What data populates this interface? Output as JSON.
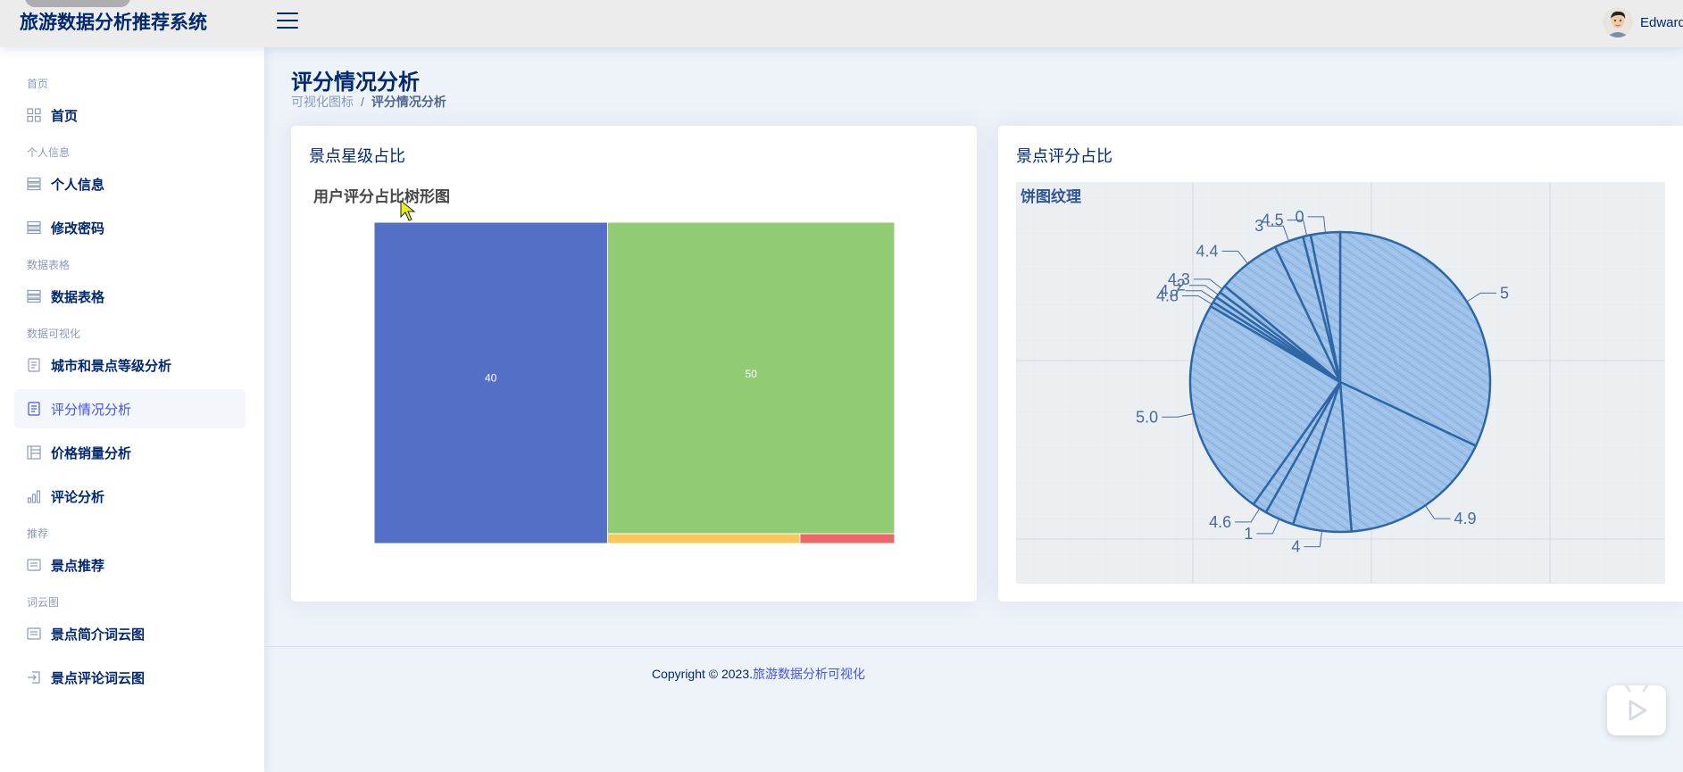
{
  "header": {
    "brand": "旅游数据分析推荐系统",
    "user_name": "Edward"
  },
  "sidebar": {
    "sections": [
      {
        "heading": "首页",
        "items": [
          {
            "label": "首页",
            "icon": "grid-icon"
          }
        ]
      },
      {
        "heading": "个人信息",
        "items": [
          {
            "label": "个人信息",
            "icon": "profile-icon"
          },
          {
            "label": "修改密码",
            "icon": "key-icon"
          }
        ]
      },
      {
        "heading": "数据表格",
        "items": [
          {
            "label": "数据表格",
            "icon": "table-icon"
          }
        ]
      },
      {
        "heading": "数据可视化",
        "items": [
          {
            "label": "城市和景点等级分析",
            "icon": "document-icon"
          },
          {
            "label": "评分情况分析",
            "icon": "document-icon",
            "active": true
          },
          {
            "label": "价格销量分析",
            "icon": "layout-icon"
          },
          {
            "label": "评论分析",
            "icon": "bar-chart-icon"
          }
        ]
      },
      {
        "heading": "推荐",
        "items": [
          {
            "label": "景点推荐",
            "icon": "card-icon"
          }
        ]
      },
      {
        "heading": "词云图",
        "items": [
          {
            "label": "景点简介词云图",
            "icon": "card-list-icon"
          },
          {
            "label": "景点评论词云图",
            "icon": "login-icon"
          }
        ]
      }
    ]
  },
  "page": {
    "title": "评分情况分析",
    "breadcrumb": [
      "可视化图标",
      "评分情况分析"
    ]
  },
  "cards": {
    "left": {
      "title": "景点星级占比",
      "chart_title": "用户评分占比树形图"
    },
    "right": {
      "title": "景点评分占比",
      "chart_title": "饼图纹理"
    }
  },
  "footer": {
    "prefix": "Copyright © 2023.",
    "link": "旅游数据分析可视化"
  },
  "chart_data": [
    {
      "type": "treemap",
      "title": "用户评分占比树形图",
      "labels_shown": [
        "40",
        "50"
      ],
      "nodes": [
        {
          "value": 40,
          "color": "#5470c6"
        },
        {
          "value": 50,
          "color": "#91cc75"
        },
        {
          "color": "#fac858"
        },
        {
          "color": "#ee6666"
        }
      ]
    },
    {
      "type": "pie",
      "title": "饼图纹理",
      "labels": [
        "5",
        "4.9",
        "4",
        "1",
        "4.6",
        "5.0",
        "4.8",
        "4.7",
        "2",
        "4.3",
        "4.4",
        "3",
        "4.5",
        "0"
      ],
      "values": [
        30.5,
        16,
        6,
        3,
        1.5,
        22.5,
        0.5,
        0.6,
        0.6,
        0.8,
        6.5,
        3,
        0.8,
        3
      ]
    }
  ]
}
